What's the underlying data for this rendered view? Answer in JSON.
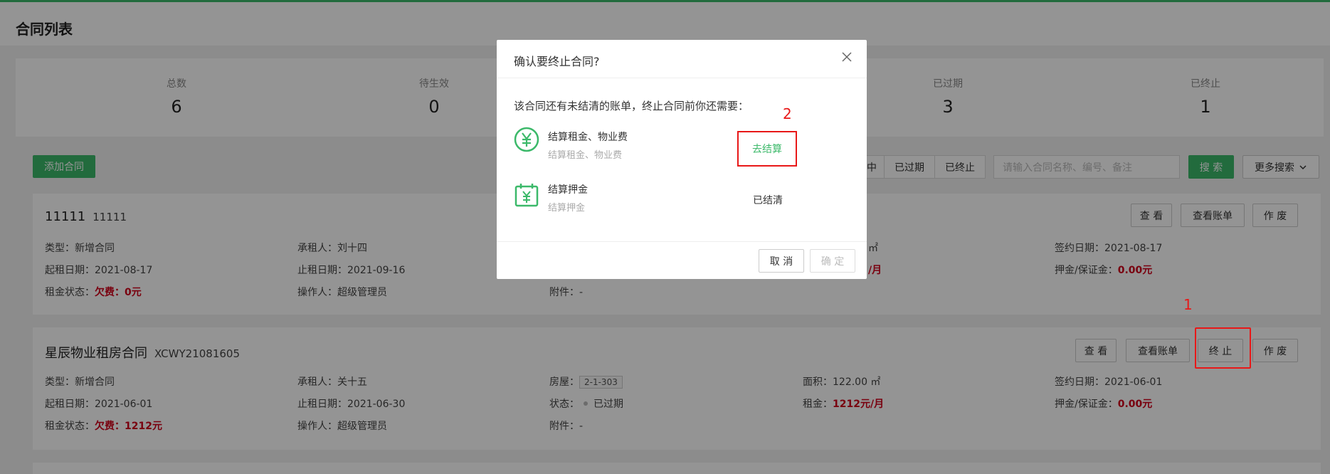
{
  "page": {
    "title": "合同列表"
  },
  "stats": [
    {
      "label": "总数",
      "value": "6"
    },
    {
      "label": "待生效",
      "value": "0"
    },
    {
      "label": "已过期",
      "value": "3"
    },
    {
      "label": "已终止",
      "value": "1"
    }
  ],
  "toolbar": {
    "add_label": "添加合同",
    "filter_partial": "中",
    "filter_expired": "已过期",
    "filter_terminated": "已终止",
    "search_placeholder": "请输入合同名称、编号、备注",
    "search_label": "搜 索",
    "more_search_label": "更多搜索"
  },
  "contract1": {
    "title": "11111",
    "code": "11111",
    "actions": {
      "view": "查 看",
      "view_bill": "查看账单",
      "void": "作 废"
    },
    "type": "类型：新增合同",
    "tenant": "承租人：刘十四",
    "area_unit": "㎡",
    "sign_date": "签约日期：2021-08-17",
    "start_date": "起租日期：2021-08-17",
    "end_date": "止租日期：2021-09-16",
    "rent_unit": "/月",
    "deposit_label": "押金/保证金：",
    "deposit_value": "0.00元",
    "rent_status_label": "租金状态：",
    "rent_status_value": "欠费：0元",
    "operator": "操作人：超级管理员",
    "attachment": "附件：-"
  },
  "contract2": {
    "title": "星辰物业租房合同",
    "code": "XCWY21081605",
    "actions": {
      "view": "查 看",
      "view_bill": "查看账单",
      "terminate": "终 止",
      "void": "作 废"
    },
    "type": "类型：新增合同",
    "tenant": "承租人：关十五",
    "house_label": "房屋：",
    "house_value": "2-1-303",
    "area": "面积：122.00 ㎡",
    "sign_date": "签约日期：2021-06-01",
    "start_date": "起租日期：2021-06-01",
    "end_date": "止租日期：2021-06-30",
    "status_label": "状态：",
    "status_value": "已过期",
    "rent_label": "租金：",
    "rent_value": "1212元/月",
    "deposit_label": "押金/保证金：",
    "deposit_value": "0.00元",
    "rent_status_label": "租金状态：",
    "rent_status_value": "欠费：1212元",
    "operator": "操作人：超级管理员",
    "attachment": "附件：-"
  },
  "annotations": {
    "step1": "1",
    "step2": "2"
  },
  "modal": {
    "title": "确认要终止合同?",
    "message": "该合同还有未结清的账单，终止合同前你还需要：",
    "items": [
      {
        "name": "结算租金、物业费",
        "sub": "结算租金、物业费",
        "icon": "yuan-circle-icon",
        "action": "去结算"
      },
      {
        "name": "结算押金",
        "sub": "结算押金",
        "icon": "calendar-yuan-icon",
        "status": "已结清"
      }
    ],
    "cancel_label": "取 消",
    "confirm_label": "确 定"
  },
  "colors": {
    "accent": "#3cb96a",
    "danger": "#d0021b",
    "annotation": "#e81818"
  }
}
